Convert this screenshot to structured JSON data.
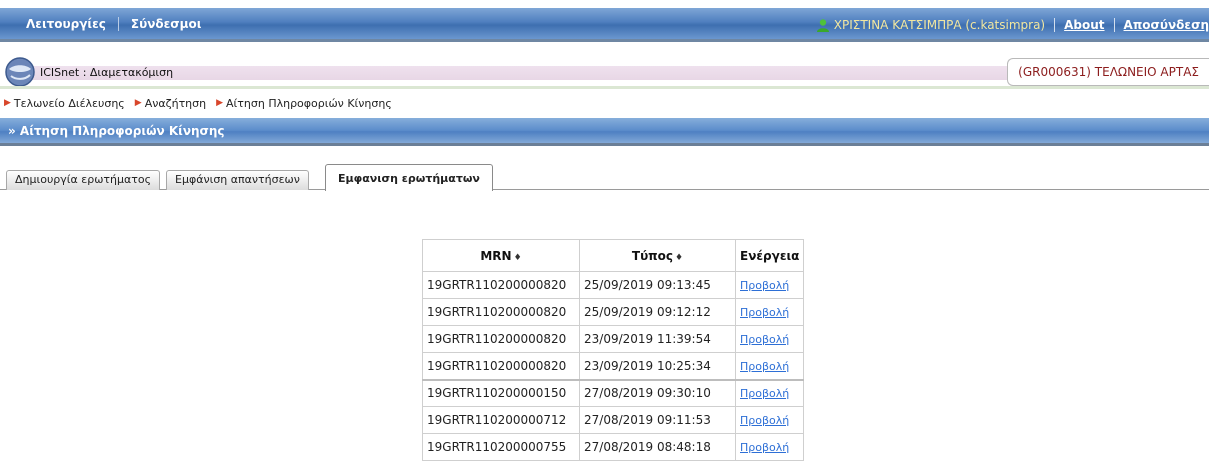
{
  "topbar": {
    "menu": [
      "Λειτουργίες",
      "Σύνδεσμοι"
    ],
    "user": "ΧΡΙΣΤΙΝΑ ΚΑΤΣΙΜΠΡΑ (c.katsimpra)",
    "about": "About",
    "logout": "Αποσύνδεση"
  },
  "app": {
    "title": "ICISnet : Διαμετακόμιση",
    "office": "(GR000631) ΤΕΛΩΝΕΙΟ ΑΡΤΑΣ"
  },
  "breadcrumb": [
    "Τελωνείο Διέλευσης",
    "Αναζήτηση",
    "Αίτηση Πληροφοριών Κίνησης"
  ],
  "section": {
    "title": "» Αίτηση Πληροφοριών Κίνησης"
  },
  "tabs": [
    {
      "label": "Δημιουργία ερωτήματος",
      "active": false
    },
    {
      "label": "Εμφάνιση απαντήσεων",
      "active": false
    },
    {
      "label": "Εμφανιση ερωτήματων",
      "active": true
    }
  ],
  "table": {
    "headers": [
      "MRN",
      "Τύπος",
      "Ενέργεια"
    ],
    "sort_symbol": "♦",
    "rows": [
      {
        "mrn": "19GRTR110200000820",
        "date": "25/09/2019 09:13:45",
        "action": "Προβολή"
      },
      {
        "mrn": "19GRTR110200000820",
        "date": "25/09/2019 09:12:12",
        "action": "Προβολή"
      },
      {
        "mrn": "19GRTR110200000820",
        "date": "23/09/2019 11:39:54",
        "action": "Προβολή"
      },
      {
        "mrn": "19GRTR110200000820",
        "date": "23/09/2019 10:25:34",
        "action": "Προβολή"
      },
      {
        "mrn": "19GRTR110200000150",
        "date": "27/08/2019 09:30:10",
        "action": "Προβολή"
      },
      {
        "mrn": "19GRTR110200000712",
        "date": "27/08/2019 09:11:53",
        "action": "Προβολή"
      },
      {
        "mrn": "19GRTR110200000755",
        "date": "27/08/2019 08:48:18",
        "action": "Προβολή"
      }
    ]
  },
  "colors": {
    "topbar_blue": "#4f7fbf",
    "user_name": "#f2e7a0",
    "office_text": "#8c1d1d",
    "link": "#2d6fd6"
  }
}
